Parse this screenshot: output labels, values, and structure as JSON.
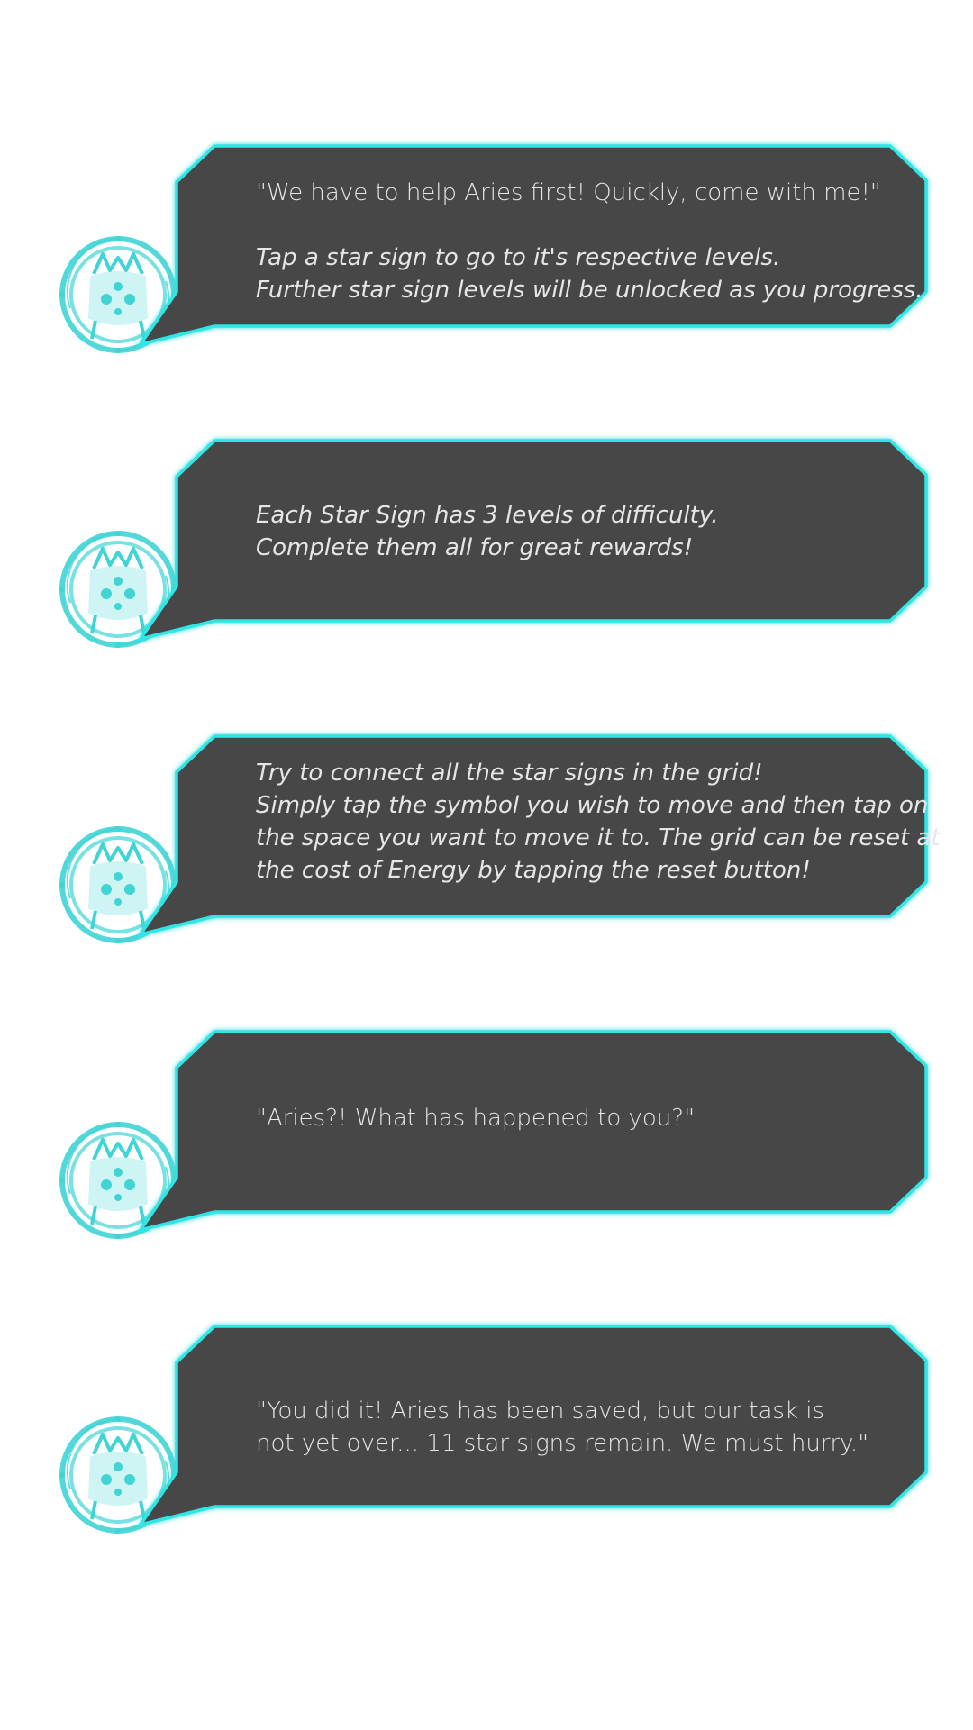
{
  "colors": {
    "bubble_fill": "#464646",
    "bubble_border": "#2ee6e6",
    "avatar_cyan": "#40d4d4",
    "text": "#e6e6e6",
    "background": "#ffffff"
  },
  "dialogs": [
    {
      "speaker_icon": "zodiac-spirit-avatar-icon",
      "lines": [
        {
          "text": "\"We have to help Aries first! Quickly, come with me!\"",
          "style": "quote"
        },
        {
          "text": "",
          "style": "quote"
        },
        {
          "text": "Tap a star sign to go to it's respective levels.",
          "style": "hint"
        },
        {
          "text": "Further star sign levels will be unlocked as you progress.",
          "style": "hint"
        }
      ]
    },
    {
      "speaker_icon": "zodiac-spirit-avatar-icon",
      "lines": [
        {
          "text": "Each Star Sign has 3 levels of difficulty.",
          "style": "hint"
        },
        {
          "text": "Complete them all for great rewards!",
          "style": "hint"
        }
      ]
    },
    {
      "speaker_icon": "zodiac-spirit-avatar-icon",
      "lines": [
        {
          "text": "Try to connect all the star signs in the grid!",
          "style": "hint"
        },
        {
          "text": "Simply tap the symbol you wish to move and then tap on",
          "style": "hint"
        },
        {
          "text": "the space you want to move it to. The grid can be reset at",
          "style": "hint"
        },
        {
          "text": "the cost of Energy by tapping the reset button!",
          "style": "hint"
        }
      ]
    },
    {
      "speaker_icon": "zodiac-spirit-avatar-icon",
      "lines": [
        {
          "text": "\"Aries?! What has happened to you?\"",
          "style": "quote"
        }
      ]
    },
    {
      "speaker_icon": "zodiac-spirit-avatar-icon",
      "lines": [
        {
          "text": "\"You did it! Aries has been saved, but our task is",
          "style": "quote"
        },
        {
          "text": "not yet over... 11 star signs remain. We must hurry.\"",
          "style": "quote"
        }
      ]
    }
  ]
}
